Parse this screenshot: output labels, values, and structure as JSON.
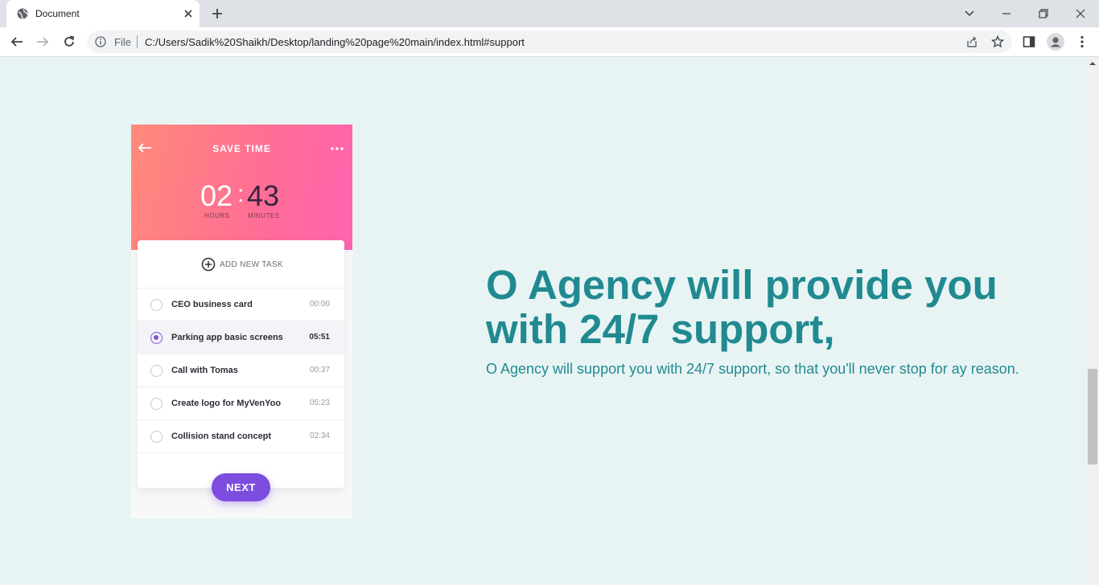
{
  "browser": {
    "tab_title": "Document",
    "omnibox_file_label": "File",
    "url": "C:/Users/Sadik%20Shaikh/Desktop/landing%20page%20main/index.html#support"
  },
  "phone": {
    "header_title": "SAVE TIME",
    "timer": {
      "hours": "02",
      "separator": ":",
      "minutes": "43",
      "hours_label": "HOURS",
      "minutes_label": "MINUTES"
    },
    "add_task_label": "ADD NEW TASK",
    "tasks": [
      {
        "name": "CEO business card",
        "time": "00:00",
        "selected": false
      },
      {
        "name": "Parking app basic screens",
        "time": "05:51",
        "selected": true
      },
      {
        "name": "Call with Tomas",
        "time": "00:37",
        "selected": false
      },
      {
        "name": "Create logo for MyVenYoo",
        "time": "05:23",
        "selected": false
      },
      {
        "name": "Collision stand concept",
        "time": "02:34",
        "selected": false
      }
    ],
    "next_label": "NEXT"
  },
  "support": {
    "headline": "O Agency will provide you with 24/7 support,",
    "subline": "O Agency will support you with 24/7 support, so that you'll never stop for ay reason."
  },
  "colors": {
    "page_background": "#e8f4f4",
    "accent_teal": "#218a91",
    "button_purple": "#7c4ddf"
  }
}
